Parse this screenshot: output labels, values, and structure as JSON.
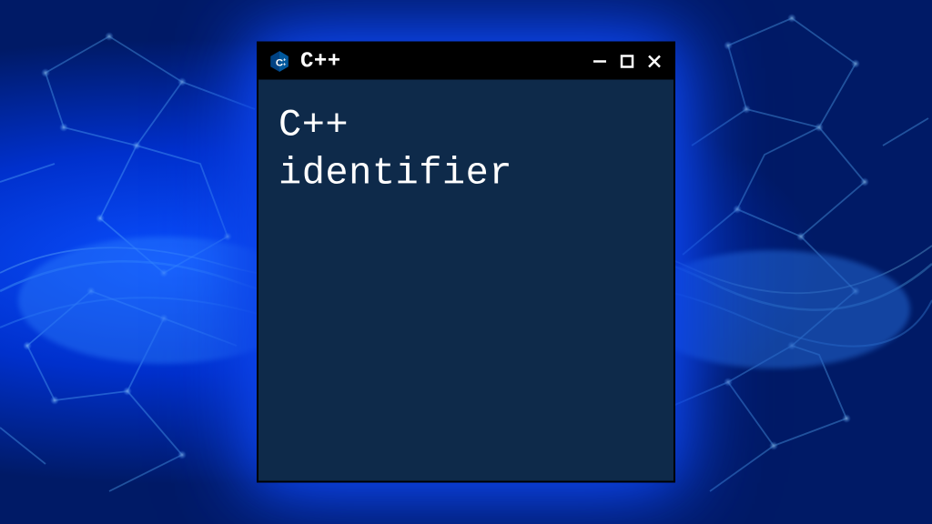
{
  "window": {
    "title": "C++",
    "content_line1": "C++",
    "content_line2": "identifier"
  }
}
